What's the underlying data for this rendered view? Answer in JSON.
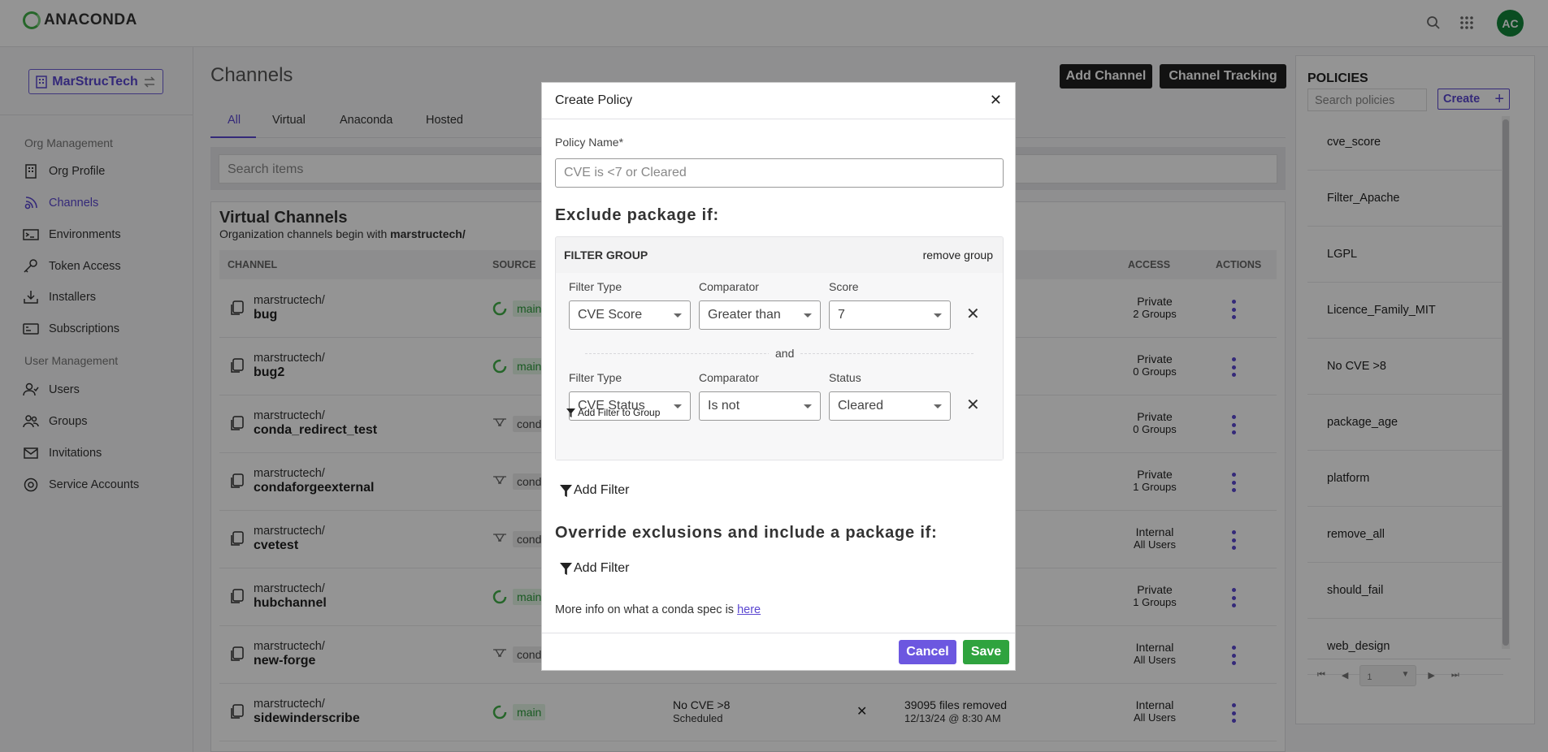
{
  "brand": {
    "name": "ANACONDA",
    "accent": "#5b47d1",
    "green": "#43b049"
  },
  "topbar": {
    "avatar_initials": "AC"
  },
  "sidebar": {
    "org_name": "MarStrucTech",
    "org_management": "Org Management",
    "org_items": [
      {
        "label": "Org Profile",
        "icon": "building-icon"
      },
      {
        "label": "Channels",
        "icon": "channels-icon",
        "active": true
      },
      {
        "label": "Environments",
        "icon": "terminal-icon"
      },
      {
        "label": "Token Access",
        "icon": "key-icon"
      },
      {
        "label": "Installers",
        "icon": "download-icon"
      },
      {
        "label": "Subscriptions",
        "icon": "card-icon"
      }
    ],
    "user_management": "User Management",
    "user_items": [
      {
        "label": "Users",
        "icon": "user-icon"
      },
      {
        "label": "Groups",
        "icon": "group-icon"
      },
      {
        "label": "Invitations",
        "icon": "mail-icon"
      },
      {
        "label": "Service Accounts",
        "icon": "service-icon"
      }
    ]
  },
  "main": {
    "title": "Channels",
    "add_channel": "Add Channel",
    "channel_tracking": "Channel Tracking",
    "tabs": [
      "All",
      "Virtual",
      "Anaconda",
      "Hosted"
    ],
    "search_placeholder": "Search items",
    "panel_title": "Virtual Channels",
    "panel_sub_prefix": "Organization channels begin with ",
    "panel_sub_bold": "marstructech/",
    "columns": {
      "channel": "CHANNEL",
      "source": "SOURCE",
      "access": "ACCESS",
      "actions": "ACTIONS"
    },
    "rows": [
      {
        "org": "marstructech/",
        "name": "bug",
        "source": "main",
        "source_type": "main",
        "access": "Private",
        "groups": "2 Groups"
      },
      {
        "org": "marstructech/",
        "name": "bug2",
        "source": "main",
        "source_type": "main",
        "access": "Private",
        "groups": "0 Groups"
      },
      {
        "org": "marstructech/",
        "name": "conda_redirect_test",
        "source": "conda",
        "source_type": "conda",
        "access": "Private",
        "groups": "0 Groups"
      },
      {
        "org": "marstructech/",
        "name": "condaforgeexternal",
        "source": "conda",
        "source_type": "conda",
        "access": "Private",
        "groups": "1 Groups"
      },
      {
        "org": "marstructech/",
        "name": "cvetest",
        "source": "conda",
        "source_type": "conda",
        "access": "Internal",
        "groups": "All Users"
      },
      {
        "org": "marstructech/",
        "name": "hubchannel",
        "source": "main",
        "source_type": "main",
        "access": "Private",
        "groups": "1 Groups"
      },
      {
        "org": "marstructech/",
        "name": "new-forge",
        "source": "conda",
        "source_type": "conda",
        "access": "Internal",
        "groups": "All Users"
      },
      {
        "org": "marstructech/",
        "name": "sidewinderscribe",
        "source": "main",
        "source_type": "main",
        "policy": "No CVE >8",
        "policy_state": "Scheduled",
        "files": "39095 files removed",
        "files_date": "12/13/24 @ 8:30 AM",
        "access": "Internal",
        "groups": "All Users"
      }
    ]
  },
  "policies": {
    "title": "POLICIES",
    "search_placeholder": "Search policies",
    "create_label": "Create",
    "items": [
      "cve_score",
      "Filter_Apache",
      "LGPL",
      "Licence_Family_MIT",
      "No CVE >8",
      "package_age",
      "platform",
      "remove_all",
      "should_fail",
      "web_design"
    ],
    "page": "1"
  },
  "modal": {
    "title": "Create Policy",
    "policy_name_label": "Policy Name*",
    "policy_name_placeholder": "CVE is <7 or Cleared",
    "exclude_heading": "Exclude package if:",
    "filter_group_title": "FILTER GROUP",
    "remove_group": "remove group",
    "filter1": {
      "type_label": "Filter Type",
      "type_value": "CVE Score",
      "comparator_label": "Comparator",
      "comparator_value": "Greater than",
      "value_label": "Score",
      "value": "7"
    },
    "and_label": "and",
    "filter2": {
      "type_label": "Filter Type",
      "type_value": "CVE Status",
      "comparator_label": "Comparator",
      "comparator_value": "Is not",
      "value_label": "Status",
      "value": "Cleared"
    },
    "add_filter_to_group": "Add Filter to Group",
    "add_filter": "Add Filter",
    "override_heading": "Override exclusions and include a package if:",
    "add_filter_2": "Add Filter",
    "more_info_prefix": "More info on what a conda spec is ",
    "more_info_link": "here",
    "cancel": "Cancel",
    "save": "Save"
  }
}
